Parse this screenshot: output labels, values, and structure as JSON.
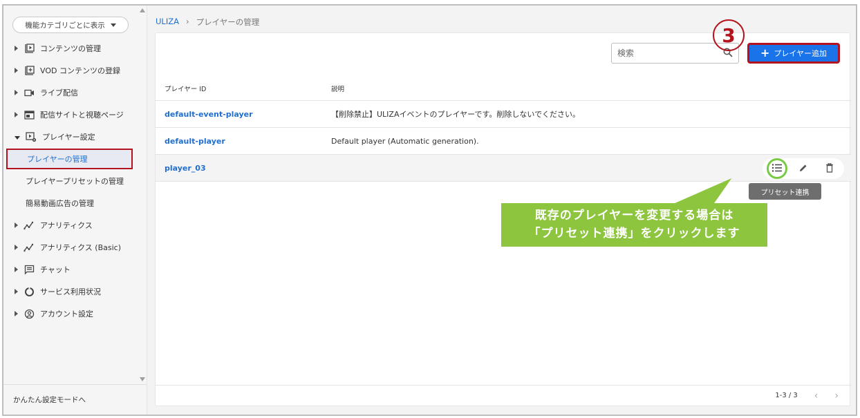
{
  "sidebar": {
    "category_select": "機能カテゴリごとに表示",
    "items": [
      {
        "label": "コンテンツの管理"
      },
      {
        "label": "VOD コンテンツの登録"
      },
      {
        "label": "ライブ配信"
      },
      {
        "label": "配信サイトと視聴ページ"
      },
      {
        "label": "プレイヤー設定"
      }
    ],
    "sub_items": [
      {
        "label": "プレイヤーの管理"
      },
      {
        "label": "プレイヤープリセットの管理"
      },
      {
        "label": "簡易動画広告の管理"
      }
    ],
    "items_after": [
      {
        "label": "アナリティクス"
      },
      {
        "label": "アナリティクス (Basic)"
      },
      {
        "label": "チャット"
      },
      {
        "label": "サービス利用状況"
      },
      {
        "label": "アカウント設定"
      }
    ],
    "footer": "かんたん設定モードへ"
  },
  "breadcrumb": {
    "root": "ULIZA",
    "sep": "›",
    "current": "プレイヤーの管理"
  },
  "search": {
    "placeholder": "検索"
  },
  "add_button": {
    "label": "プレイヤー追加"
  },
  "step_badge": "3",
  "table": {
    "headers": {
      "id": "プレイヤー ID",
      "desc": "説明"
    },
    "rows": [
      {
        "id": "default-event-player",
        "desc": "【削除禁止】ULIZAイベントのプレイヤーです。削除しないでください。"
      },
      {
        "id": "default-player",
        "desc": "Default player (Automatic generation)."
      },
      {
        "id": "player_03",
        "desc": ""
      }
    ]
  },
  "tooltip": "プリセット連携",
  "callout": {
    "line1": "既存のプレイヤーを変更する場合は",
    "line2": "「プリセット連携」をクリックします"
  },
  "pager": {
    "range": "1-3 / 3",
    "prev": "‹",
    "next": "›"
  },
  "colors": {
    "accent": "#1a73e8",
    "highlight_red": "#b3131c",
    "callout_green": "#8dc53e"
  }
}
